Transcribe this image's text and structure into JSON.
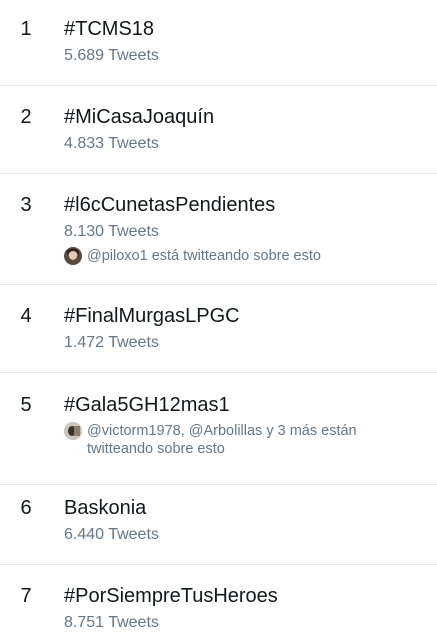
{
  "trends": [
    {
      "rank": "1",
      "name": "#TCMS18",
      "count": "5.689 Tweets"
    },
    {
      "rank": "2",
      "name": "#MiCasaJoaquín",
      "count": "4.833 Tweets"
    },
    {
      "rank": "3",
      "name": "#l6cCunetasPendientes",
      "count": "8.130 Tweets",
      "context": "@piloxo1 está twitteando sobre esto",
      "context_avatar": "user-avatar-piloxo1"
    },
    {
      "rank": "4",
      "name": "#FinalMurgasLPGC",
      "count": "1.472 Tweets"
    },
    {
      "rank": "5",
      "name": "#Gala5GH12mas1",
      "context_line1": "@victorm1978, @Arbolillas y 3 más están",
      "context_line2": "twitteando sobre esto",
      "context_avatar": "user-avatar-victorm1978"
    },
    {
      "rank": "6",
      "name": "Baskonia",
      "count": "6.440 Tweets"
    },
    {
      "rank": "7",
      "name": "#PorSiempreTusHeroes",
      "count": "8.751 Tweets"
    }
  ],
  "colors": {
    "text_primary": "#14171a",
    "text_secondary": "#657786",
    "divider": "#e1e8ed",
    "background": "#ffffff"
  }
}
